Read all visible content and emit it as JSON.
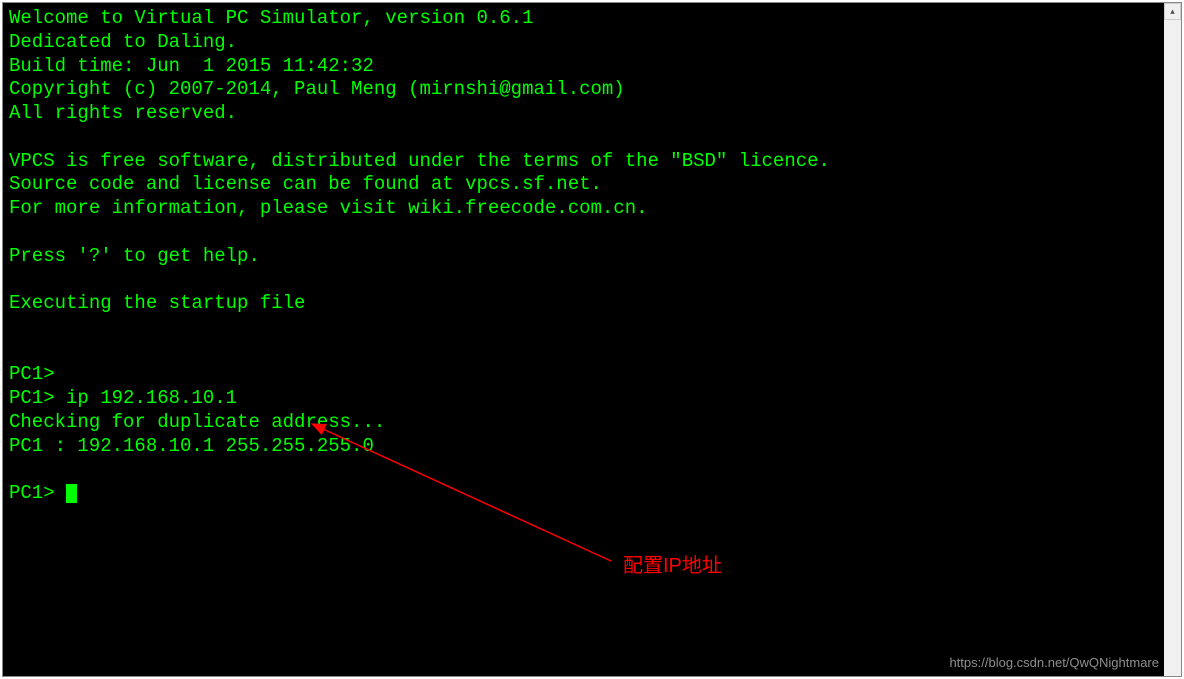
{
  "terminal": {
    "lines": [
      "Welcome to Virtual PC Simulator, version 0.6.1",
      "Dedicated to Daling.",
      "Build time: Jun  1 2015 11:42:32",
      "Copyright (c) 2007-2014, Paul Meng (mirnshi@gmail.com)",
      "All rights reserved.",
      "",
      "VPCS is free software, distributed under the terms of the \"BSD\" licence.",
      "Source code and license can be found at vpcs.sf.net.",
      "For more information, please visit wiki.freecode.com.cn.",
      "",
      "Press '?' to get help.",
      "",
      "Executing the startup file",
      "",
      "",
      "PC1>",
      "PC1> ip 192.168.10.1",
      "Checking for duplicate address...",
      "PC1 : 192.168.10.1 255.255.255.0",
      "",
      "PC1> "
    ],
    "prompt_final": "PC1> "
  },
  "annotation": {
    "label": "配置IP地址"
  },
  "watermark": "https://blog.csdn.net/QwQNightmare",
  "scroll": {
    "up_glyph": "▴"
  }
}
